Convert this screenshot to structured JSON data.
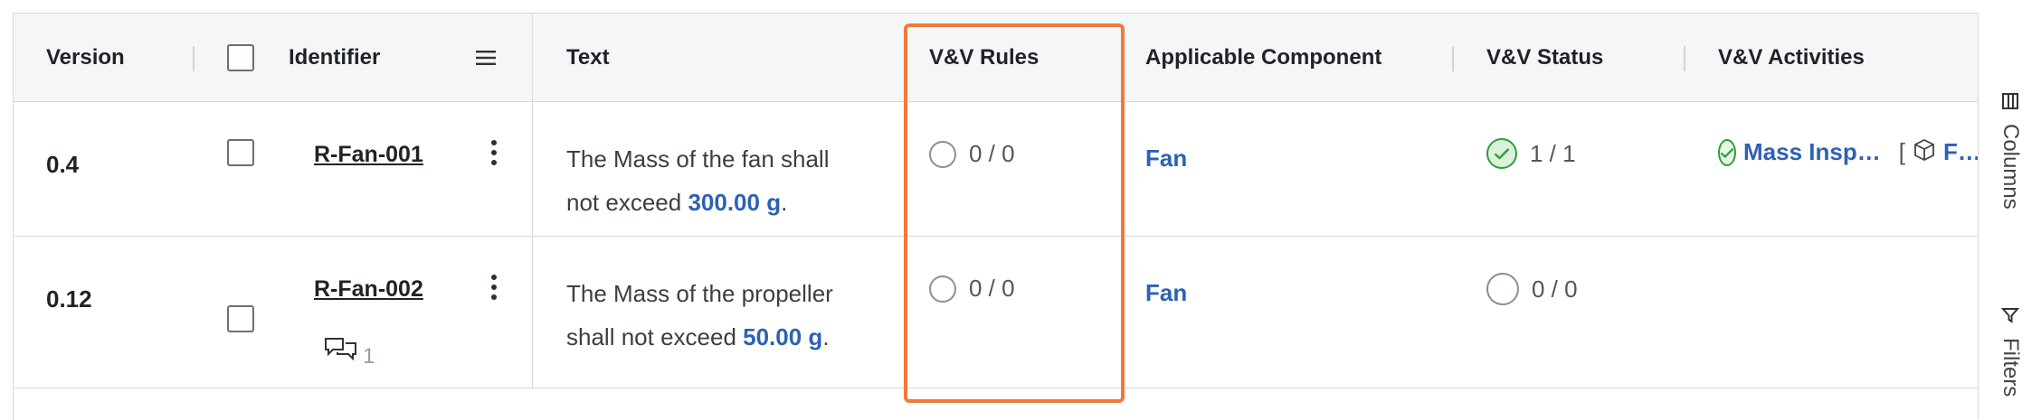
{
  "columns": {
    "version": "Version",
    "identifier": "Identifier",
    "text": "Text",
    "vv_rules": "V&V Rules",
    "applicable_component": "Applicable Component",
    "vv_status": "V&V Status",
    "vv_activities": "V&V Activities"
  },
  "rows": [
    {
      "version": "0.4",
      "identifier": "R-Fan-001",
      "text_before": "The Mass of the fan shall not exceed",
      "value": "300.00  g",
      "text_after": ".",
      "vv_rules": "0 / 0",
      "component": "Fan",
      "vv_status": "1 / 1",
      "activity_label": "Mass Insp…",
      "activity_bracket": "[",
      "activity_component": "F…"
    },
    {
      "version": "0.12",
      "identifier": "R-Fan-002",
      "text_before": "The Mass of the propeller shall not exceed",
      "value": "50.00  g",
      "text_after": ".",
      "vv_rules": "0 / 0",
      "component": "Fan",
      "vv_status": "0 / 0",
      "comment_count": "1"
    }
  ],
  "side_panel": {
    "columns": "Columns",
    "filters": "Filters"
  },
  "colors": {
    "accent_link": "#2e61b3",
    "highlight": "#f07a3a",
    "success": "#2e9c3f"
  }
}
